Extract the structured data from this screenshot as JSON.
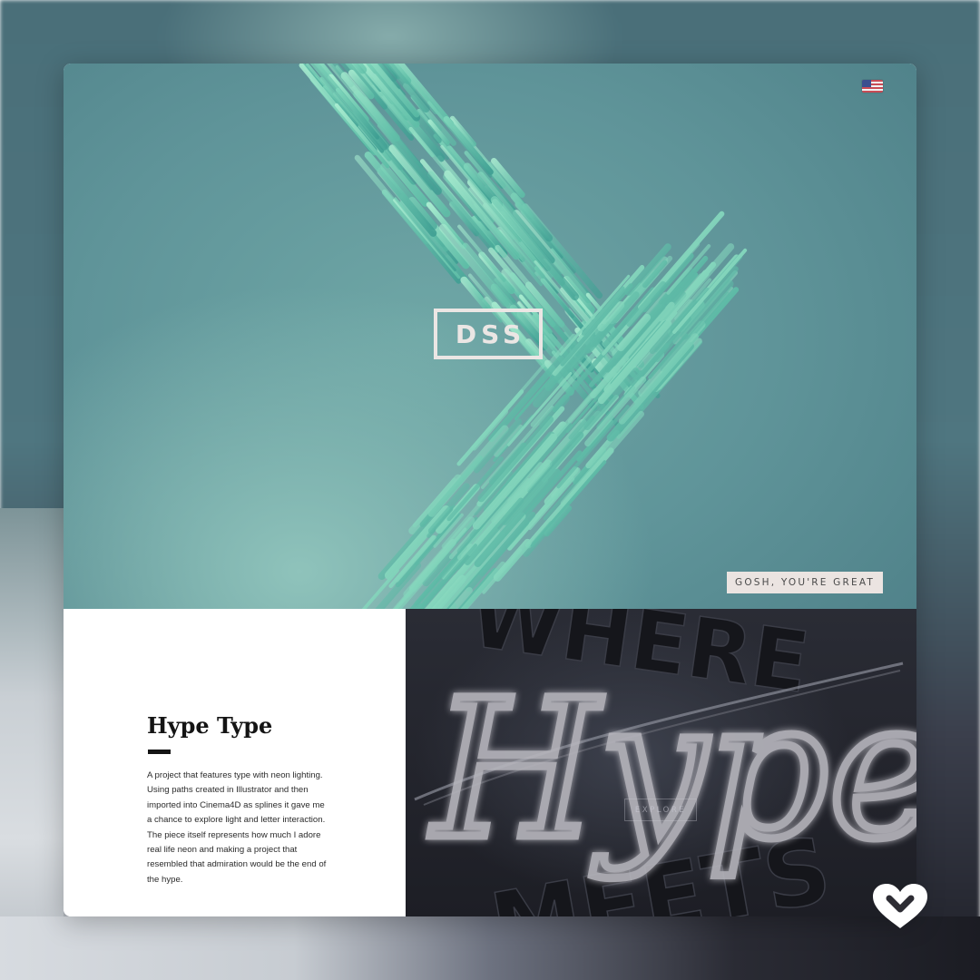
{
  "hero": {
    "logo_text": "DSS",
    "tagline": "GOSH, YOU'RE GREAT",
    "flag_icon": "us-flag-icon"
  },
  "project": {
    "title": "Hype Type",
    "description": "A project that features type with neon lighting. Using paths created in Illustrator and then imported into Cinema4D as splines it gave me a chance to explore light and letter interaction. The piece itself represents how much I adore real life neon and making a project that resembled that admiration would be the end of the hype.",
    "explore_label": "EXPLORE",
    "thumbnail_neon_text": "Hype",
    "thumbnail_back_text_top": "WHERE",
    "thumbnail_back_text_bottom": "MEETS"
  },
  "overlay": {
    "like_icon": "heart-icon"
  },
  "colors": {
    "hero_teal": "#5f9499",
    "crystal_mint": "#8fd8bd",
    "logo_ink": "#ebe6e4",
    "dark_panel": "#1d1e25",
    "title_ink": "#141414"
  }
}
